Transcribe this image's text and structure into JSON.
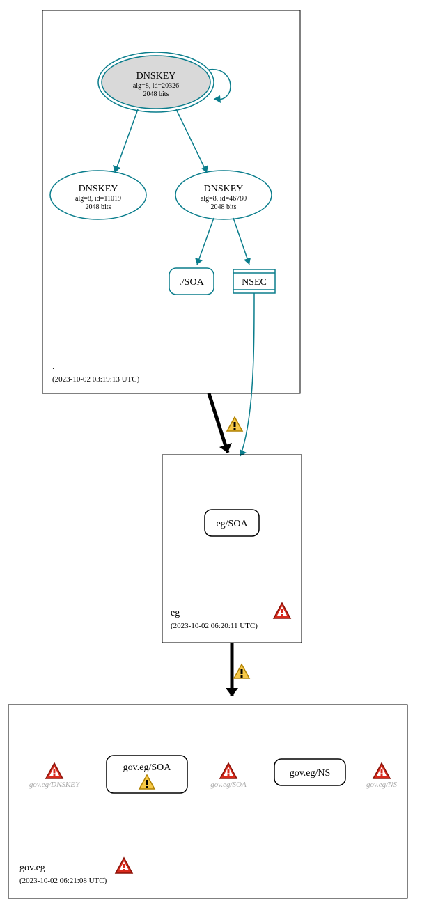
{
  "zones": {
    "root": {
      "name": ".",
      "timestamp": "(2023-10-02 03:19:13 UTC)",
      "ksk": {
        "title": "DNSKEY",
        "params": "alg=8, id=20326",
        "bits": "2048 bits"
      },
      "zsk1": {
        "title": "DNSKEY",
        "params": "alg=8, id=11019",
        "bits": "2048 bits"
      },
      "zsk2": {
        "title": "DNSKEY",
        "params": "alg=8, id=46780",
        "bits": "2048 bits"
      },
      "soa": "./SOA",
      "nsec": "NSEC"
    },
    "eg": {
      "name": "eg",
      "timestamp": "(2023-10-02 06:20:11 UTC)",
      "soa": "eg/SOA"
    },
    "goveg": {
      "name": "gov.eg",
      "timestamp": "(2023-10-02 06:21:08 UTC)",
      "ghost_dnskey": "gov.eg/DNSKEY",
      "soa": "gov.eg/SOA",
      "ghost_soa": "gov.eg/SOA",
      "ns": "gov.eg/NS",
      "ghost_ns": "gov.eg/NS"
    }
  }
}
